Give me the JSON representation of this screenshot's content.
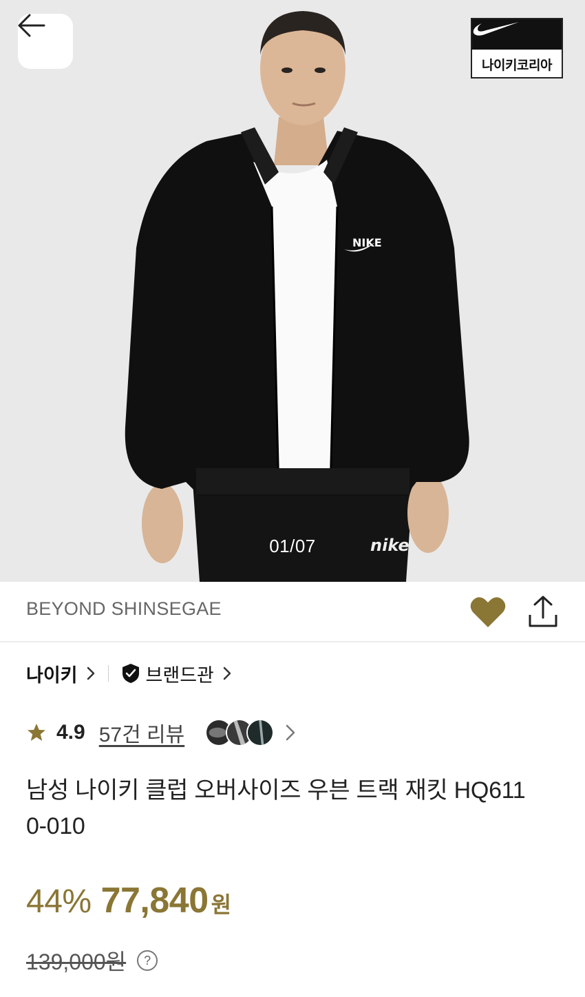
{
  "hero": {
    "image_counter": "01/07",
    "brand_badge_text": "나이키코리아"
  },
  "store": {
    "name": "BEYOND SHINSEGAE",
    "wishlisted": true,
    "accent_color": "#8a7635"
  },
  "brand": {
    "name": "나이키",
    "brand_hall_label": "브랜드관"
  },
  "rating": {
    "score": "4.9",
    "reviews_label": "57건 리뷰"
  },
  "product": {
    "title": "남성 나이키 클럽 오버사이즈 우븐 트랙 재킷 HQ6110-010",
    "title_line1": "남성 나이키 클럽 오버사이즈 우븐 트랙 재킷 HQ611",
    "title_line2": "0-010"
  },
  "price": {
    "discount": "44%",
    "sale_price": "77,840",
    "currency": "원",
    "original_price": "139,000원"
  },
  "icons": {
    "back": "arrow-left-icon",
    "heart": "heart-icon",
    "share": "share-icon",
    "shield": "shield-check-icon",
    "star": "star-icon",
    "help": "question-circle-icon"
  }
}
